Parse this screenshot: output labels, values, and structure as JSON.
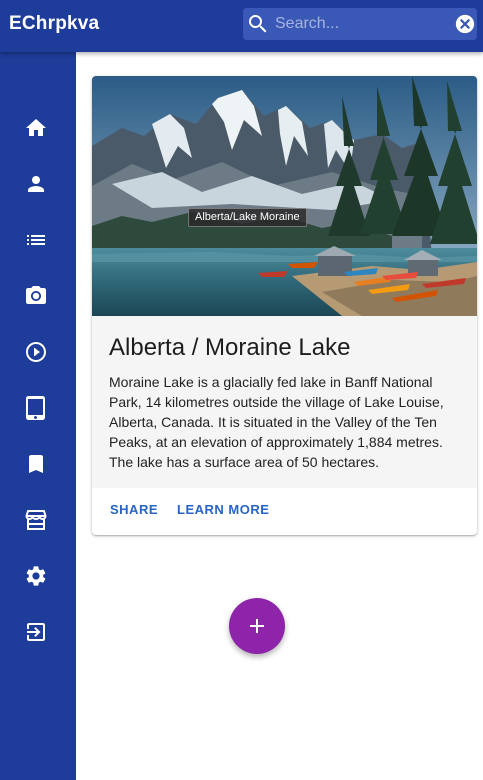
{
  "app": {
    "title": "EChrpkva"
  },
  "search": {
    "placeholder": "Search..."
  },
  "nav": [
    {
      "id": "home",
      "icon": "home-icon"
    },
    {
      "id": "account",
      "icon": "person-icon"
    },
    {
      "id": "list",
      "icon": "list-icon"
    },
    {
      "id": "camera",
      "icon": "camera-icon"
    },
    {
      "id": "play",
      "icon": "play-circle-icon"
    },
    {
      "id": "tablet",
      "icon": "tablet-icon"
    },
    {
      "id": "bookmark",
      "icon": "bookmark-icon"
    },
    {
      "id": "store",
      "icon": "store-icon"
    },
    {
      "id": "settings",
      "icon": "gear-icon"
    },
    {
      "id": "logout",
      "icon": "exit-icon"
    }
  ],
  "card": {
    "image_tooltip": "Alberta/Lake Moraine",
    "title": "Alberta / Moraine Lake",
    "description": "Moraine Lake is a glacially fed lake in Banff National Park, 14 kilometres outside the village of Lake Louise, Alberta, Canada. It is situated in the Valley of the Ten Peaks, at an elevation of approximately 1,884 metres. The lake has a surface area of 50 hectares.",
    "actions": {
      "share": "SHARE",
      "learn_more": "LEARN MORE"
    }
  },
  "fab": {
    "icon": "plus-icon"
  },
  "colors": {
    "primary": "#1e3c9a",
    "accent": "#8e24aa",
    "action_text": "#2764c5"
  }
}
